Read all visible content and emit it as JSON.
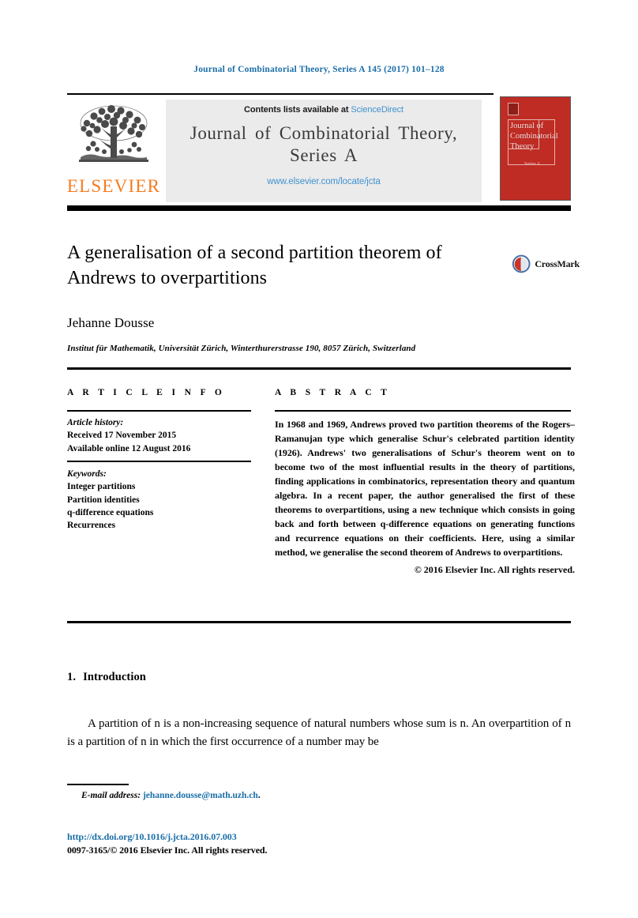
{
  "running_head": "Journal of Combinatorial Theory, Series A 145 (2017) 101–128",
  "masthead": {
    "contents_prefix": "Contents lists available at ",
    "sciencedirect_link": "ScienceDirect",
    "journal_title_line1": "Journal of Combinatorial Theory,",
    "journal_title_line2": "Series A",
    "journal_url": "www.elsevier.com/locate/jcta",
    "publisher_wordmark": "ELSEVIER",
    "publisher_logo_icon": "elsevier-tree-icon",
    "cover": {
      "title": "Journal of Combinatorial Theory",
      "subtitle": "Series A",
      "color": "#bf2c24"
    }
  },
  "article": {
    "title": "A generalisation of a second partition theorem of Andrews to overpartitions",
    "author": "Jehanne Dousse",
    "affiliation": "Institut für Mathematik, Universität Zürich, Winterthurerstrasse 190, 8057 Zürich, Switzerland",
    "crossmark_label": "CrossMark",
    "crossmark_icon": "crossmark-badge-icon"
  },
  "info": {
    "heading": "A R T I C L E   I N F O",
    "history_label": "Article history:",
    "history_lines": [
      "Received 17 November 2015",
      "Available online 12 August 2016"
    ],
    "keywords_label": "Keywords:",
    "keywords": [
      "Integer partitions",
      "Partition identities",
      "q-difference equations",
      "Recurrences"
    ]
  },
  "abstract": {
    "heading": "A B S T R A C T",
    "text": "In 1968 and 1969, Andrews proved two partition theorems of the Rogers–Ramanujan type which generalise Schur's celebrated partition identity (1926). Andrews' two generalisations of Schur's theorem went on to become two of the most influential results in the theory of partitions, finding applications in combinatorics, representation theory and quantum algebra. In a recent paper, the author generalised the first of these theorems to overpartitions, using a new technique which consists in going back and forth between q-difference equations on generating functions and recurrence equations on their coefficients. Here, using a similar method, we generalise the second theorem of Andrews to overpartitions.",
    "copyright": "© 2016 Elsevier Inc. All rights reserved."
  },
  "body": {
    "section_number": "1.",
    "section_title": "Introduction",
    "paragraph": "A partition of n is a non-increasing sequence of natural numbers whose sum is n. An overpartition of n is a partition of n in which the first occurrence of a number may be"
  },
  "footer": {
    "email_label": "E-mail address:",
    "email": "jehanne.dousse@math.uzh.ch",
    "email_suffix": ".",
    "doi": "http://dx.doi.org/10.1016/j.jcta.2016.07.003",
    "issn_line": "0097-3165/© 2016 Elsevier Inc. All rights reserved."
  },
  "colors": {
    "link_blue": "#1a6ea8",
    "sciencedirect_blue": "#3f92cf",
    "elsevier_orange": "#f47c20",
    "cover_red": "#bf2c24"
  }
}
